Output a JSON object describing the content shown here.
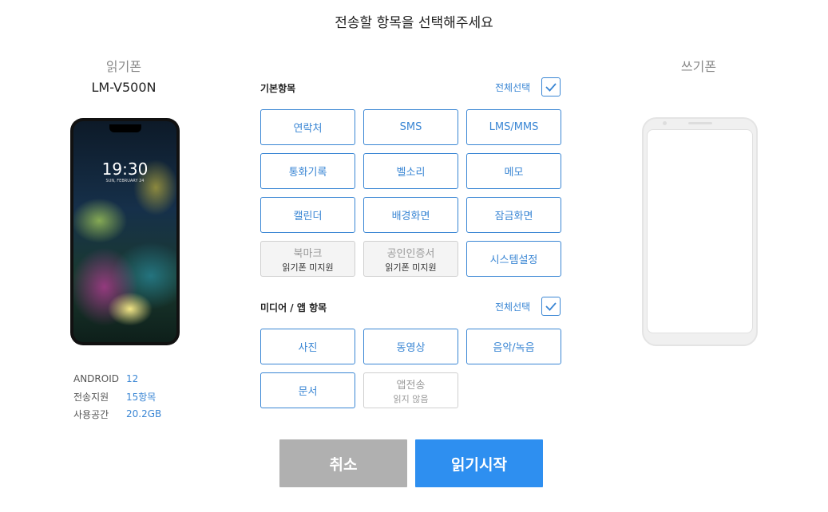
{
  "title": "전송할 항목을 선택해주세요",
  "read_phone": {
    "label": "읽기폰",
    "model": "LM-V500N",
    "clock": "19:30",
    "date": "SUN, FEBRUARY 24",
    "info": [
      {
        "key": "ANDROID",
        "value": "12"
      },
      {
        "key": "전송지원",
        "value": "15항목"
      },
      {
        "key": "사용공간",
        "value": "20.2GB"
      }
    ]
  },
  "write_phone": {
    "label": "쓰기폰"
  },
  "basic": {
    "title": "기본항목",
    "select_all": "전체선택",
    "items": [
      {
        "label": "연락처"
      },
      {
        "label": "SMS"
      },
      {
        "label": "LMS/MMS"
      },
      {
        "label": "통화기록"
      },
      {
        "label": "벨소리"
      },
      {
        "label": "메모"
      },
      {
        "label": "캘린더"
      },
      {
        "label": "배경화면"
      },
      {
        "label": "잠금화면"
      },
      {
        "label": "북마크",
        "sub": "읽기폰 미지원"
      },
      {
        "label": "공인인증서",
        "sub": "읽기폰 미지원"
      },
      {
        "label": "시스템설정"
      }
    ]
  },
  "media": {
    "title": "미디어 / 앱 항목",
    "select_all": "전체선택",
    "items": [
      {
        "label": "사진"
      },
      {
        "label": "동영상"
      },
      {
        "label": "음악/녹음"
      },
      {
        "label": "문서"
      },
      {
        "label": "앱전송",
        "sub": "읽지 않음"
      }
    ]
  },
  "buttons": {
    "cancel": "취소",
    "start": "읽기시작"
  },
  "colors": {
    "accent": "#3a86d4",
    "start_button": "#2e8ff0",
    "cancel_button": "#b0b0b0"
  }
}
